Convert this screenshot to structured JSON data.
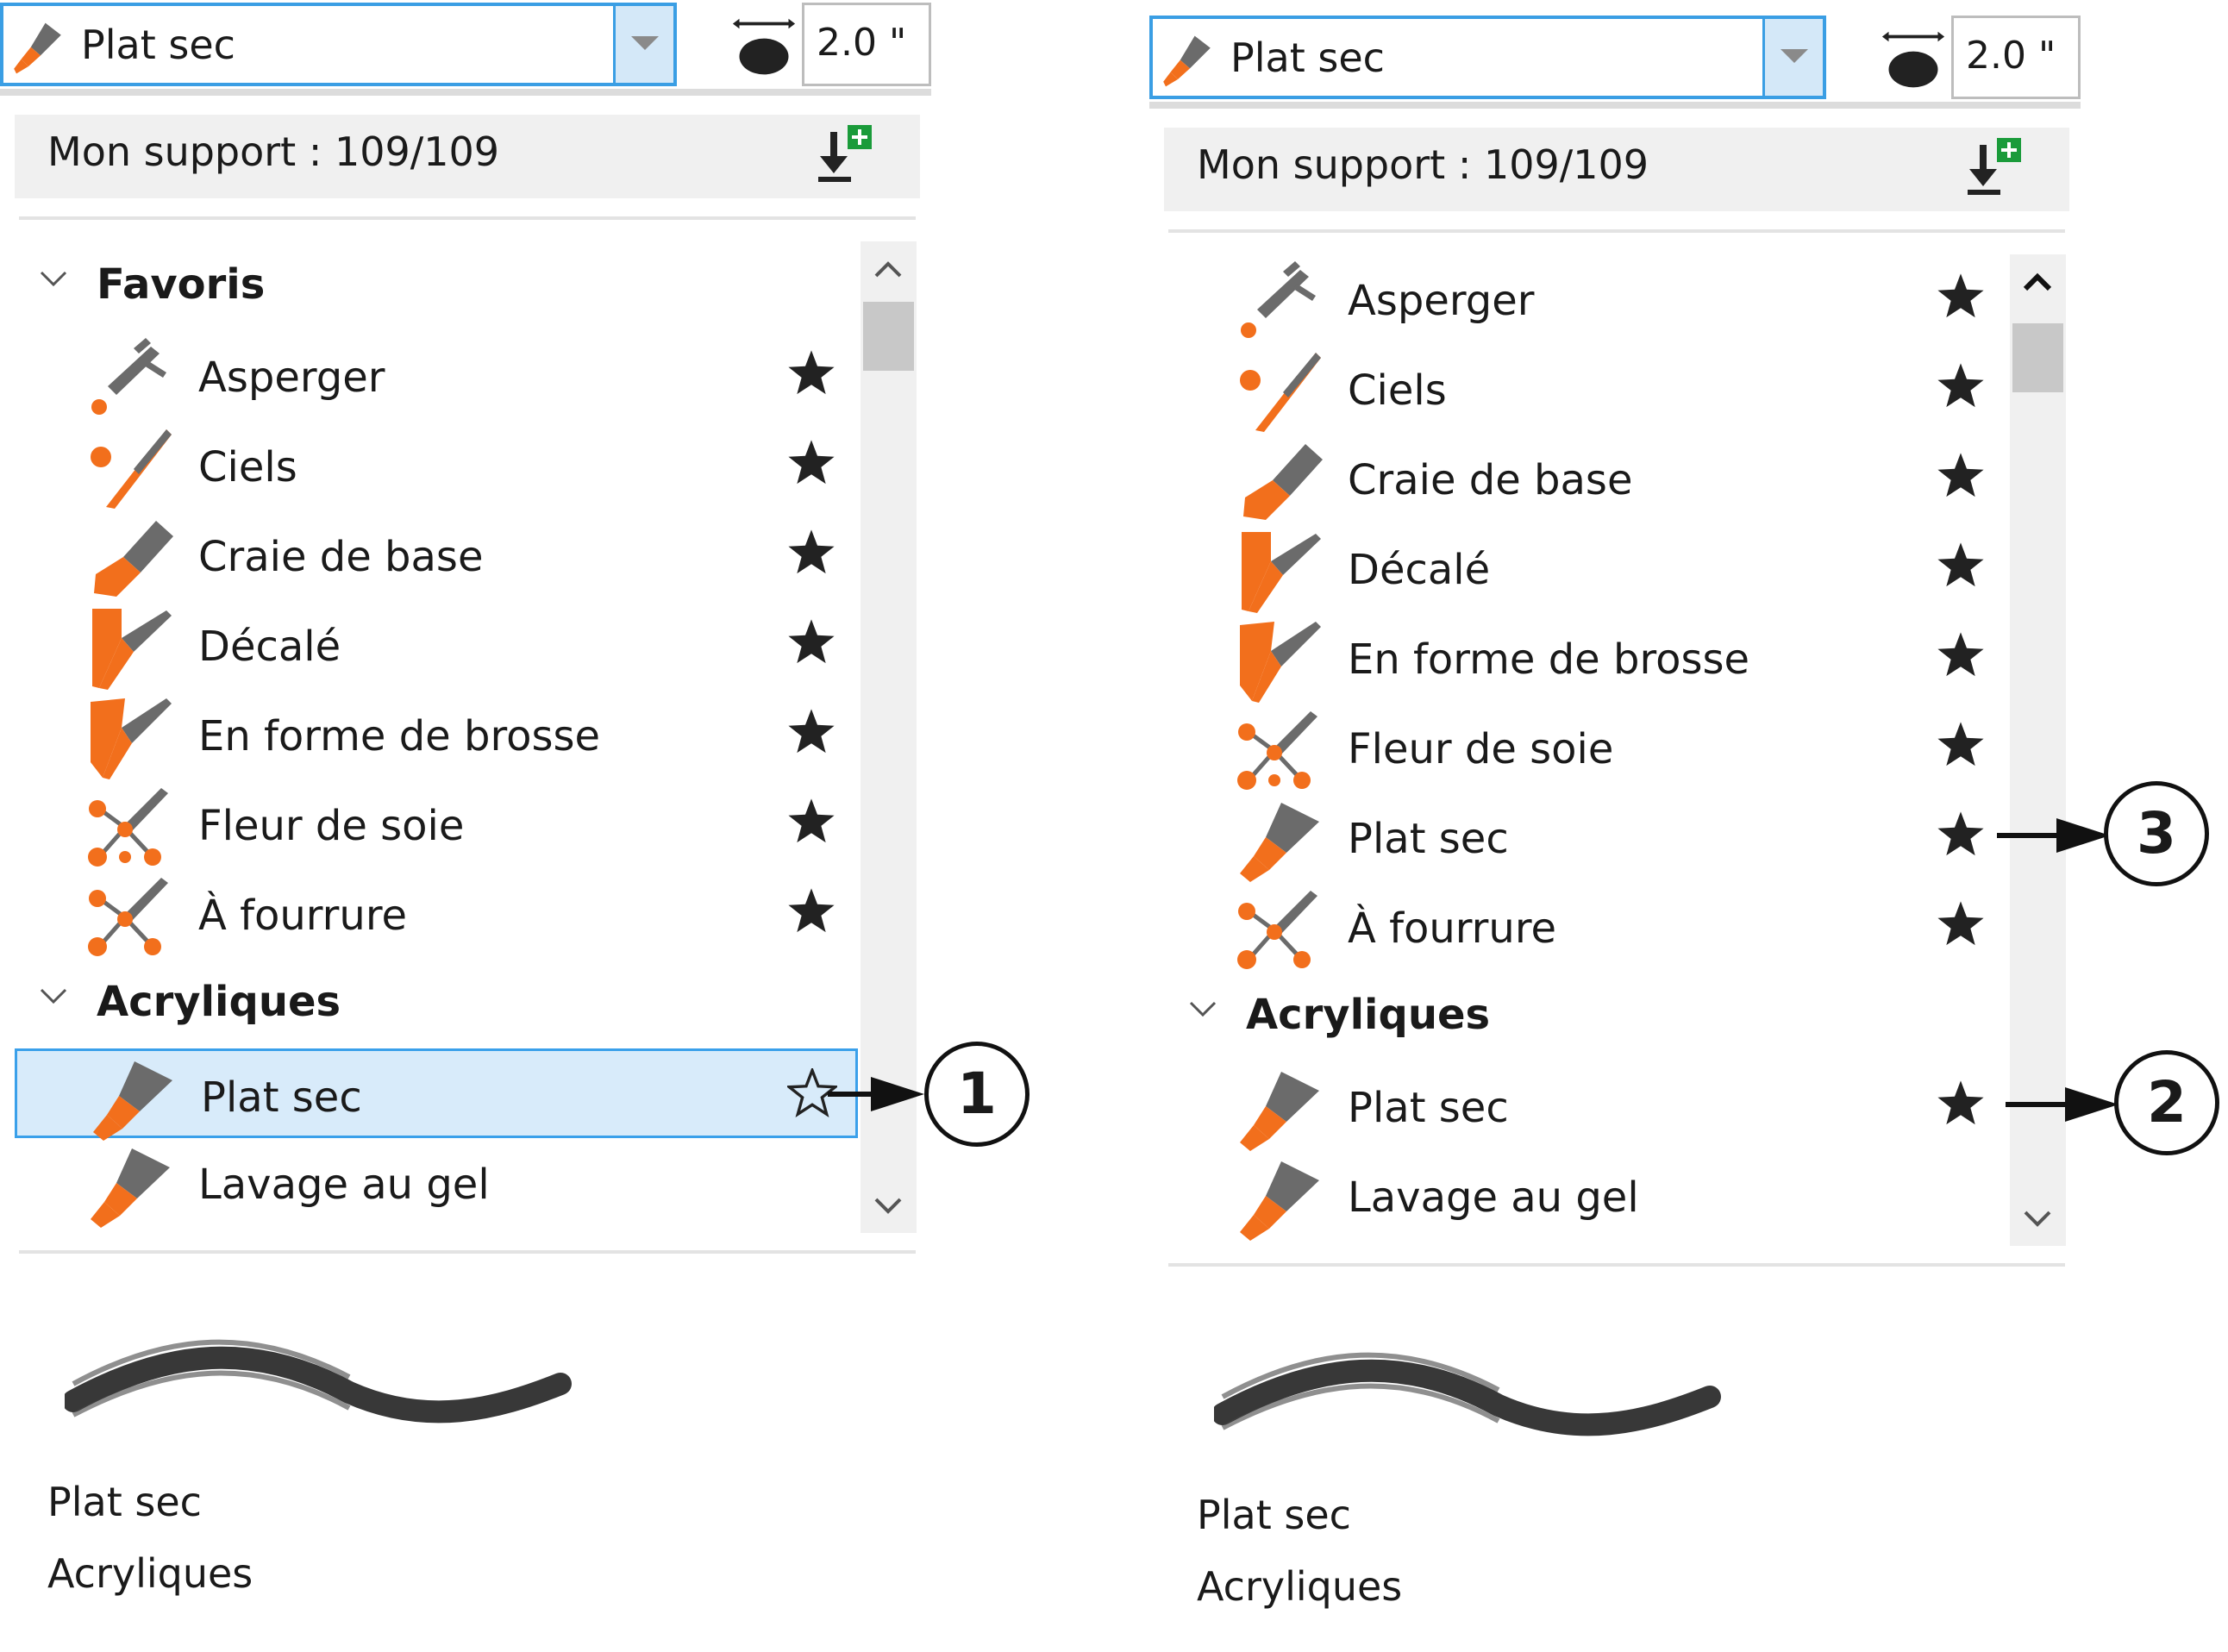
{
  "toolbar": {
    "brush_name": "Plat sec",
    "size_value": "2.0 \""
  },
  "support": {
    "label": "Mon support : 109/109"
  },
  "left_list": {
    "groups": [
      {
        "label": "Favoris",
        "items": [
          {
            "label": "Asperger",
            "icon": "airbrush-icon",
            "favorite": true
          },
          {
            "label": "Ciels",
            "icon": "sky-brush-icon",
            "favorite": true
          },
          {
            "label": "Craie de base",
            "icon": "chalk-icon",
            "favorite": true
          },
          {
            "label": "Décalé",
            "icon": "offset-brush-icon",
            "favorite": true
          },
          {
            "label": "En forme de brosse",
            "icon": "brush-shape-icon",
            "favorite": true
          },
          {
            "label": "Fleur de soie",
            "icon": "silk-flower-icon",
            "favorite": true
          },
          {
            "label": "À fourrure",
            "icon": "fur-brush-icon",
            "favorite": true
          }
        ]
      },
      {
        "label": "Acryliques",
        "items": [
          {
            "label": "Plat sec",
            "icon": "flat-brush-icon",
            "favorite": false,
            "selected": true
          },
          {
            "label": "Lavage au gel",
            "icon": "flat-brush-icon",
            "favorite": false
          }
        ]
      }
    ]
  },
  "right_list": {
    "favorites": [
      {
        "label": "Asperger",
        "icon": "airbrush-icon",
        "favorite": true
      },
      {
        "label": "Ciels",
        "icon": "sky-brush-icon",
        "favorite": true
      },
      {
        "label": "Craie de base",
        "icon": "chalk-icon",
        "favorite": true
      },
      {
        "label": "Décalé",
        "icon": "offset-brush-icon",
        "favorite": true
      },
      {
        "label": "En forme de brosse",
        "icon": "brush-shape-icon",
        "favorite": true
      },
      {
        "label": "Fleur de soie",
        "icon": "silk-flower-icon",
        "favorite": true
      },
      {
        "label": "Plat sec",
        "icon": "flat-brush-icon",
        "favorite": true
      },
      {
        "label": "À fourrure",
        "icon": "fur-brush-icon",
        "favorite": true
      }
    ],
    "group": {
      "label": "Acryliques",
      "items": [
        {
          "label": "Plat sec",
          "icon": "flat-brush-icon",
          "favorite": true
        },
        {
          "label": "Lavage au gel",
          "icon": "flat-brush-icon",
          "favorite": false
        }
      ]
    }
  },
  "preview": {
    "brush_name": "Plat sec",
    "category": "Acryliques"
  },
  "callouts": {
    "one": "1",
    "two": "2",
    "three": "3"
  },
  "colors": {
    "accent": "#3a9ee4",
    "icon_orange": "#f26f1c",
    "icon_gray": "#6b6b6b",
    "selection": "#d8ebfa"
  }
}
